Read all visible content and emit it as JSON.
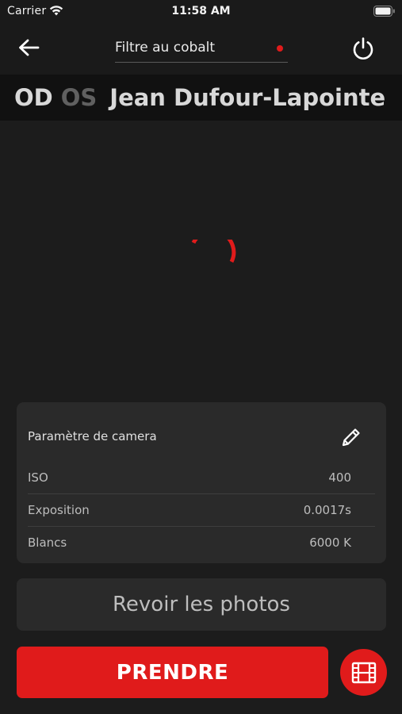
{
  "status_bar": {
    "carrier": "Carrier",
    "time": "11:58 AM"
  },
  "nav": {
    "filter_label": "Filtre au cobalt",
    "filter_indicator_color": "#e01b1b"
  },
  "patient": {
    "eye_right": "OD",
    "eye_left": "OS",
    "eye_selected": "OD",
    "name": "Jean Dufour-Lapointe"
  },
  "camera_settings": {
    "title": "Paramètre de camera",
    "rows": [
      {
        "label": "ISO",
        "value": "400"
      },
      {
        "label": "Exposition",
        "value": "0.0017s"
      },
      {
        "label": "Blancs",
        "value": "6000 K"
      }
    ]
  },
  "actions": {
    "review_label": "Revoir les photos",
    "take_label": "PRENDRE"
  },
  "colors": {
    "accent": "#e01b1b",
    "background": "#1c1c1c",
    "card": "#2a2a2a"
  },
  "icons": {
    "back": "arrow-left-icon",
    "power": "power-icon",
    "edit": "pencil-icon",
    "video": "film-strip-icon",
    "loading": "loading-spinner-icon"
  }
}
